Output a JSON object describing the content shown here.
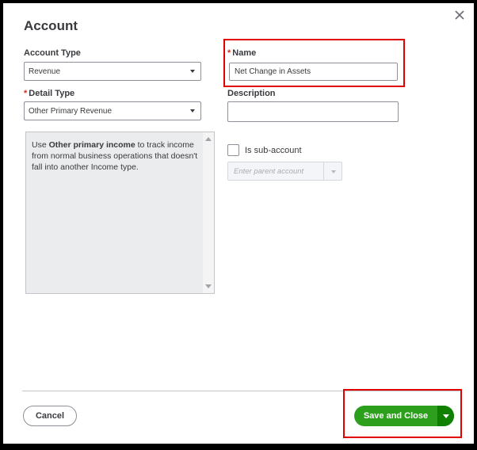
{
  "dialog": {
    "title": "Account",
    "close_icon": "close-icon"
  },
  "account_type": {
    "label": "Account Type",
    "value": "Revenue"
  },
  "detail_type": {
    "required_mark": "*",
    "label": "Detail Type",
    "value": "Other Primary Revenue"
  },
  "name": {
    "required_mark": "*",
    "label": "Name",
    "value": "Net Change in Assets"
  },
  "description": {
    "label": "Description",
    "value": ""
  },
  "help": {
    "prefix": "Use ",
    "bold": "Other primary income",
    "suffix": " to track income from normal business operations that doesn't fall into another Income type."
  },
  "sub_account": {
    "label": "Is sub-account",
    "checked": false,
    "parent_placeholder": "Enter parent account"
  },
  "footer": {
    "cancel_label": "Cancel",
    "save_label": "Save and Close"
  },
  "colors": {
    "required": "#d52b1e",
    "primary": "#2ca01c",
    "primary_dark": "#108000",
    "highlight": "#e00000"
  }
}
